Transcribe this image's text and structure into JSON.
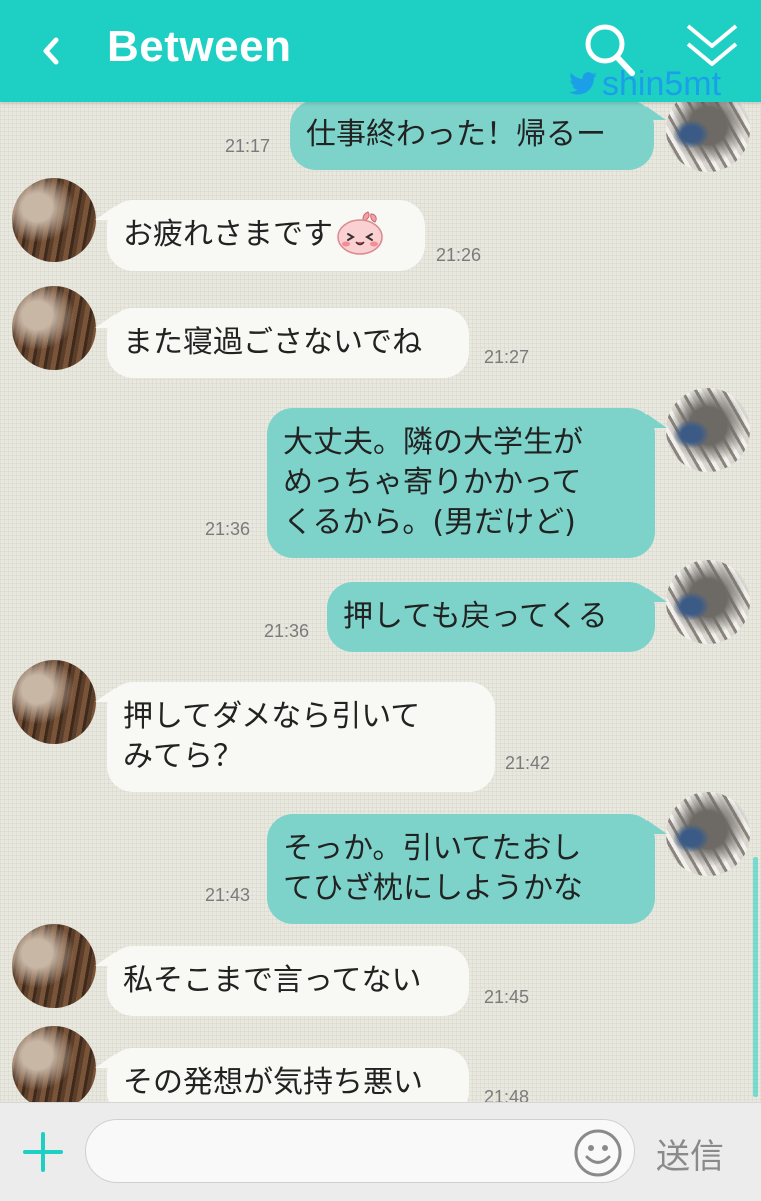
{
  "header": {
    "title": "Between",
    "back_icon": "chevron-left-icon",
    "search_icon": "search-icon",
    "collapse_icon": "double-chevron-down-icon",
    "watermark": "shin5mt",
    "background": "#1ecfc4"
  },
  "messages": [
    {
      "side": "out",
      "text": "仕事終わった！帰るー",
      "time": "21:17"
    },
    {
      "side": "in",
      "text": "お疲れさまです",
      "emoji": "peach-face-emoji",
      "time": "21:26"
    },
    {
      "side": "in",
      "text": "また寝過ごさないでね",
      "time": "21:27"
    },
    {
      "side": "out",
      "lines": [
        "大丈夫。隣の大学生が",
        "めっちゃ寄りかかって",
        "くるから。(男だけど)"
      ],
      "time": "21:36"
    },
    {
      "side": "out",
      "text": "押しても戻ってくる",
      "time": "21:36"
    },
    {
      "side": "in",
      "lines": [
        "押してダメなら引いて",
        "みてら？"
      ],
      "time": "21:42"
    },
    {
      "side": "out",
      "lines": [
        "そっか。引いてたおし",
        "てひざ枕にしようかな"
      ],
      "time": "21:43"
    },
    {
      "side": "in",
      "text": "私そこまで言ってない",
      "time": "21:45"
    },
    {
      "side": "in",
      "text": "その発想が気持ち悪い",
      "time": "21:48"
    }
  ],
  "composer": {
    "plus_icon": "plus-icon",
    "input_value": "",
    "smiley_icon": "smiley-icon",
    "send_label": "送信"
  },
  "colors": {
    "outgoing_bubble": "#7dd3ca",
    "incoming_bubble": "#f8f8f4",
    "accent": "#1ecfc4"
  }
}
